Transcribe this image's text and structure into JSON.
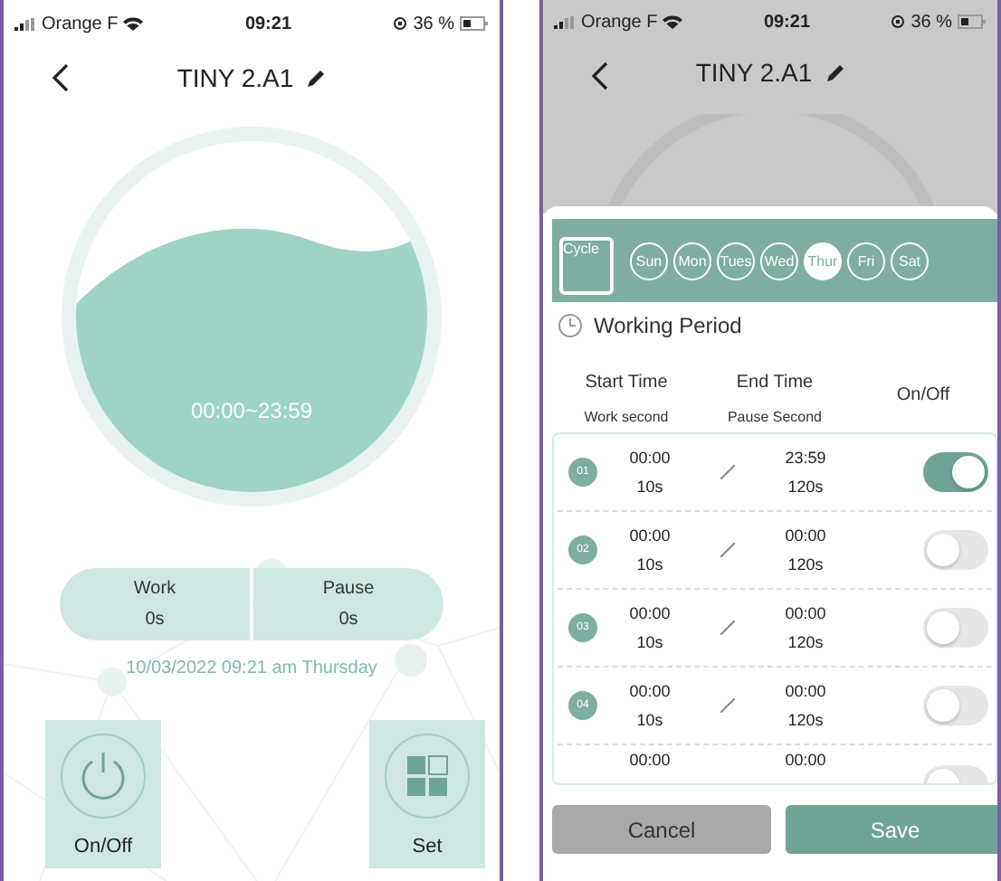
{
  "screens": [
    {
      "status_bar": {
        "carrier": "Orange F",
        "time": "09:21",
        "battery": "36 %"
      },
      "title": "TINY 2.A1",
      "dial": {
        "range": "00:00~23:59"
      },
      "counters": [
        {
          "label": "Work",
          "value": "0s"
        },
        {
          "label": "Pause",
          "value": "0s"
        }
      ],
      "datetime": "10/03/2022 09:21 am Thursday",
      "actions": [
        {
          "kind": "power",
          "label": "On/Off"
        },
        {
          "kind": "grid",
          "label": "Set"
        }
      ]
    },
    {
      "status_bar": {
        "carrier": "Orange F",
        "time": "09:21",
        "battery": "36 %"
      },
      "title": "TINY 2.A1",
      "schedule": {
        "cycle_label": "Cycle",
        "days": [
          {
            "label": "Sun",
            "selected": false
          },
          {
            "label": "Mon",
            "selected": false
          },
          {
            "label": "Tues",
            "selected": false
          },
          {
            "label": "Wed",
            "selected": false
          },
          {
            "label": "Thur",
            "selected": true
          },
          {
            "label": "Fri",
            "selected": false
          },
          {
            "label": "Sat",
            "selected": false
          }
        ],
        "section_title": "Working Period",
        "headers": {
          "start": "Start Time",
          "end": "End Time",
          "toggle": "On/Off",
          "work": "Work second",
          "pause": "Pause Second"
        },
        "periods": [
          {
            "number": "01",
            "start": "00:00",
            "work": "10s",
            "end": "23:59",
            "pause": "120s",
            "on": true
          },
          {
            "number": "02",
            "start": "00:00",
            "work": "10s",
            "end": "00:00",
            "pause": "120s",
            "on": false
          },
          {
            "number": "03",
            "start": "00:00",
            "work": "10s",
            "end": "00:00",
            "pause": "120s",
            "on": false
          },
          {
            "number": "04",
            "start": "00:00",
            "work": "10s",
            "end": "00:00",
            "pause": "120s",
            "on": false
          },
          {
            "start": "00:00",
            "end": "00:00",
            "on": false
          }
        ],
        "buttons": [
          {
            "kind": "cancel",
            "label": "Cancel"
          },
          {
            "kind": "save",
            "label": "Save"
          }
        ]
      }
    }
  ]
}
